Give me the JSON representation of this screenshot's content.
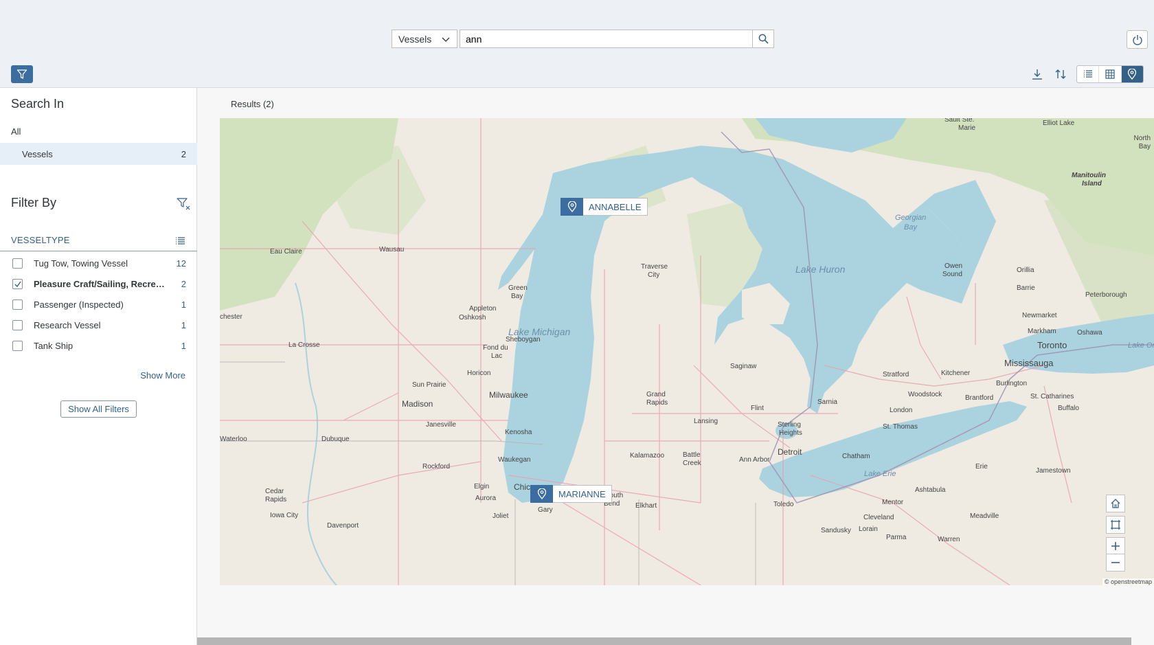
{
  "header": {
    "scope": "Vessels",
    "search_value": "ann",
    "icons": {
      "search": "search-icon",
      "power": "power-icon",
      "filter": "filter-icon"
    }
  },
  "toolbar": {
    "icons": [
      "download-icon",
      "sort-icon",
      "list-view-icon",
      "table-view-icon",
      "map-view-icon"
    ],
    "active_view": "map"
  },
  "sidebar": {
    "search_in_title": "Search In",
    "all_label": "All",
    "selected": {
      "label": "Vessels",
      "count": "2"
    },
    "filter_by_title": "Filter By",
    "facet": {
      "name": "VESSELTYPE",
      "items": [
        {
          "label": "Tug Tow, Towing Vessel",
          "count": "12",
          "checked": false
        },
        {
          "label": "Pleasure Craft/Sailing, Recreational",
          "count": "2",
          "checked": true
        },
        {
          "label": "Passenger (Inspected)",
          "count": "1",
          "checked": false
        },
        {
          "label": "Research Vessel",
          "count": "1",
          "checked": false
        },
        {
          "label": "Tank Ship",
          "count": "1",
          "checked": false
        }
      ],
      "show_more": "Show More"
    },
    "show_all_filters": "Show All Filters"
  },
  "main": {
    "results_label": "Results (2)",
    "map": {
      "attribution": "© openstreetmap",
      "pins": [
        {
          "label": "ANNABELLE"
        },
        {
          "label": "MARIANNE"
        }
      ],
      "lakes": [
        "Lake Michigan",
        "Lake Huron",
        "Georgian Bay",
        "Lake Erie",
        "Lake Ontario"
      ],
      "cities": [
        "Sault Ste. Marie",
        "Elliot Lake",
        "North Bay",
        "Manitoulin Island",
        "Eau Claire",
        "Wausau",
        "Green Bay",
        "Traverse City",
        "Appleton",
        "Oshkosh",
        "Owen Sound",
        "Orillia",
        "Barrie",
        "Peterborough",
        "Newmarket",
        "Markham",
        "Oshawa",
        "Toronto",
        "Mississauga",
        "Chester",
        "La Crosse",
        "Sheboygan",
        "Fond du Lac",
        "Saginaw",
        "Horicon",
        "Kitchener",
        "Burlington",
        "Stratford",
        "Sun Prairie",
        "Madison",
        "Milwaukee",
        "Grand Rapids",
        "Woodstock",
        "Brantford",
        "St. Catharines",
        "Buffalo",
        "Flint",
        "Sarnia",
        "London",
        "Janesville",
        "Lansing",
        "Sterling Heights",
        "St. Thomas",
        "Kenosha",
        "Waterloo",
        "Dubuque",
        "Waukegan",
        "Kalamazoo",
        "Battle Creek",
        "Ann Arbor",
        "Detroit",
        "Chatham",
        "Rockford",
        "Erie",
        "Jamestown",
        "Elgin",
        "Chicago",
        "Cedar Rapids",
        "Aurora",
        "South Bend",
        "Elkhart",
        "Toledo",
        "Ashtabula",
        "Mentor",
        "Iowa City",
        "Joliet",
        "Gary",
        "Meadville",
        "Cleveland",
        "Davenport",
        "Sandusky",
        "Lorain",
        "Parma",
        "Warren"
      ],
      "controls": [
        "home-icon",
        "zoom-rect-icon",
        "zoom-in-icon",
        "zoom-out-icon"
      ]
    }
  }
}
